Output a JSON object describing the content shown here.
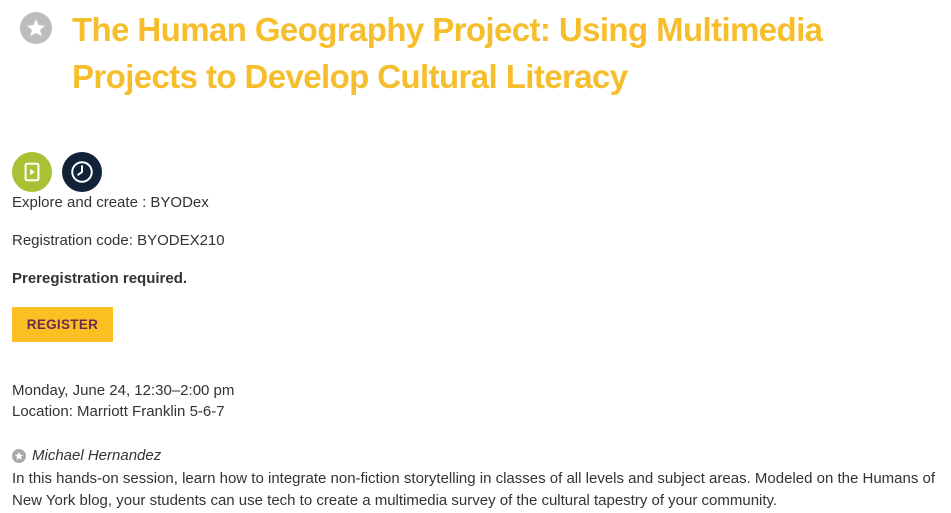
{
  "session": {
    "title": "The Human Geography Project: Using Multimedia Projects to Develop Cultural Literacy",
    "explore": "Explore and create : BYODex",
    "registration_code": "Registration code: BYODEX210",
    "preregistration": "Preregistration required.",
    "register_label": "REGISTER",
    "datetime": "Monday, June 24, 12:30–2:00 pm",
    "location": "Location: Marriott Franklin 5-6-7",
    "speaker": "Michael Hernandez",
    "description": "In this hands-on session, learn how to integrate non-fiction storytelling in classes of all levels and subject areas. Modeled on the Humans of New York blog, your students can use tech to create a multimedia survey of the cultural tapestry of your community."
  },
  "icons": {
    "favorite": "star-icon",
    "format": "play-document-icon",
    "duration": "clock-icon",
    "speaker": "star-icon"
  },
  "colors": {
    "title": "#f7be2b",
    "register_bg": "#fcbf22",
    "register_text": "#6b2d4f",
    "format_icon_bg": "#a8c234",
    "clock_icon_bg": "#102338",
    "star_bg": "#bdbdbd"
  }
}
